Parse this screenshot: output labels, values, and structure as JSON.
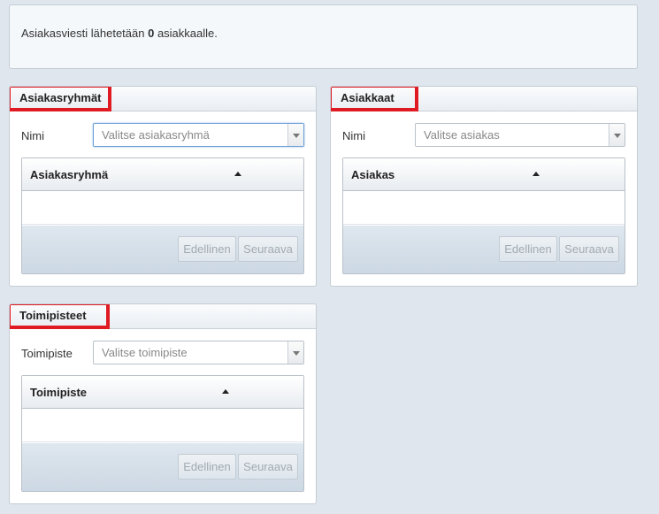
{
  "info": {
    "prefix": "Asiakasviesti lähetetään ",
    "count": "0",
    "suffix": " asiakkaalle."
  },
  "customer_groups": {
    "title": "Asiakasryhmät",
    "field_label": "Nimi",
    "select_placeholder": "Valitse asiakasryhmä",
    "column_header": "Asiakasryhmä",
    "prev_label": "Edellinen",
    "next_label": "Seuraava"
  },
  "customers": {
    "title": "Asiakkaat",
    "field_label": "Nimi",
    "select_placeholder": "Valitse asiakas",
    "column_header": "Asiakas",
    "prev_label": "Edellinen",
    "next_label": "Seuraava"
  },
  "locations": {
    "title": "Toimipisteet",
    "field_label": "Toimipiste",
    "select_placeholder": "Valitse toimipiste",
    "column_header": "Toimipiste",
    "prev_label": "Edellinen",
    "next_label": "Seuraava"
  },
  "colors": {
    "highlight": "#e01a22",
    "page_background": "#dfe6ee"
  }
}
